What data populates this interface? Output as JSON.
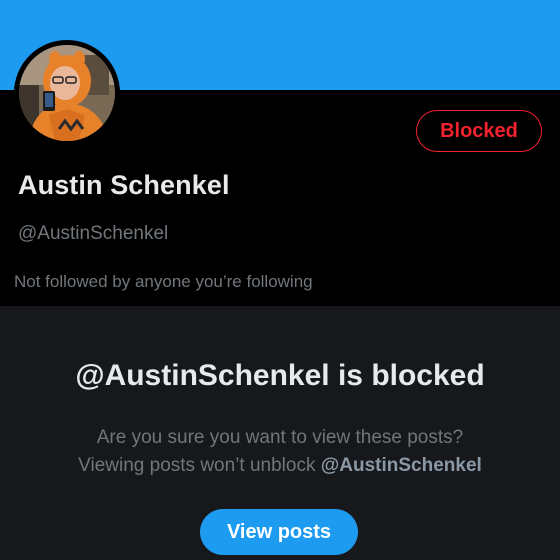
{
  "profile": {
    "display_name": "Austin Schenkel",
    "handle": "@AustinSchenkel",
    "followers_context": "Not followed by anyone you’re following",
    "blocked_button_label": "Blocked",
    "avatar_icon": "user-avatar-photo"
  },
  "blocked_notice": {
    "title": "@AustinSchenkel is blocked",
    "message_line1": "Are you sure you want to view these posts?",
    "message_line2_prefix": "Viewing posts won’t unblock ",
    "message_line2_handle": "@AustinSchenkel",
    "view_posts_label": "View posts"
  },
  "colors": {
    "banner": "#1d9bf0",
    "blocked_red": "#f4212e",
    "primary_blue": "#1d9bf0",
    "background": "#000000",
    "panel": "#16181c"
  }
}
